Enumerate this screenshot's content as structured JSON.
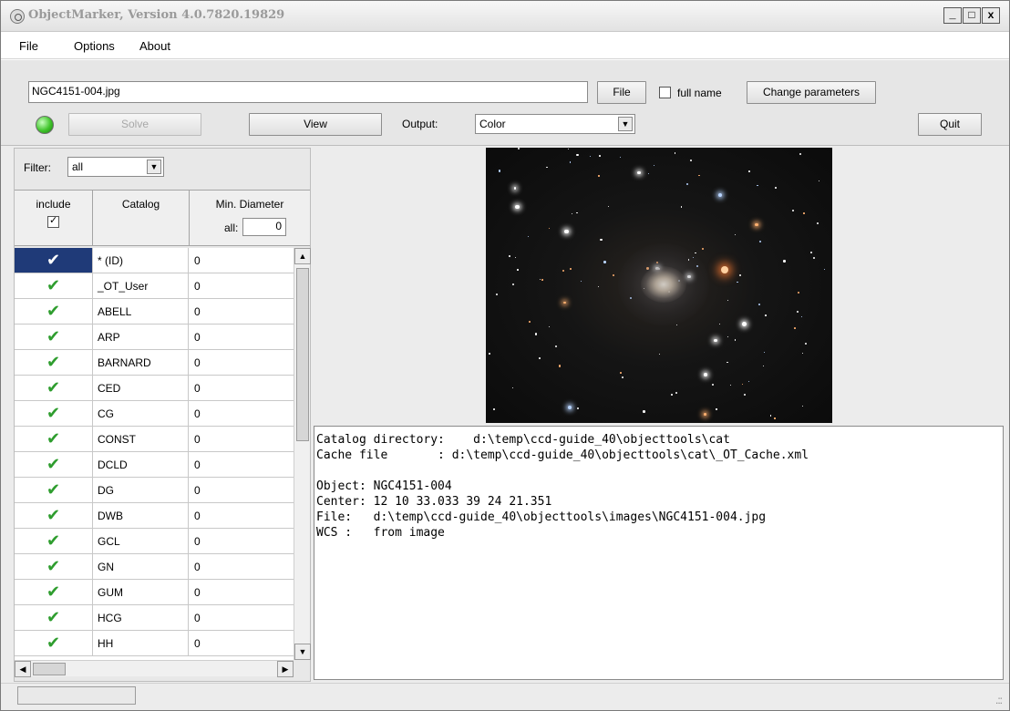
{
  "window": {
    "title": "ObjectMarker, Version 4.0.7820.19829",
    "buttons": {
      "minimize": "_",
      "maximize": "□",
      "close": "x"
    }
  },
  "menu": [
    "File",
    "Options",
    "About"
  ],
  "toolbar": {
    "filename_value": "NGC4151-004.jpg",
    "file_button": "File",
    "full_name_label": "full name",
    "full_name_checked": false,
    "change_params_button": "Change parameters",
    "solve_button": "Solve",
    "view_button": "View",
    "output_label": "Output:",
    "output_value": "Color",
    "quit_button": "Quit",
    "status_led_color": "#3fc42a"
  },
  "filter": {
    "label": "Filter:",
    "value": "all"
  },
  "grid": {
    "headers": {
      "include": "include",
      "catalog": "Catalog",
      "min_diameter": "Min. Diameter",
      "all_label": "all:",
      "all_value": "0"
    },
    "include_all_checked": true,
    "rows": [
      {
        "catalog": "* (ID)",
        "min": "0",
        "selected": true
      },
      {
        "catalog": "_OT_User",
        "min": "0"
      },
      {
        "catalog": "ABELL",
        "min": "0"
      },
      {
        "catalog": "ARP",
        "min": "0"
      },
      {
        "catalog": "BARNARD",
        "min": "0"
      },
      {
        "catalog": "CED",
        "min": "0"
      },
      {
        "catalog": "CG",
        "min": "0"
      },
      {
        "catalog": "CONST",
        "min": "0"
      },
      {
        "catalog": "DCLD",
        "min": "0"
      },
      {
        "catalog": "DG",
        "min": "0"
      },
      {
        "catalog": "DWB",
        "min": "0"
      },
      {
        "catalog": "GCL",
        "min": "0"
      },
      {
        "catalog": "GN",
        "min": "0"
      },
      {
        "catalog": "GUM",
        "min": "0"
      },
      {
        "catalog": "HCG",
        "min": "0"
      },
      {
        "catalog": "HH",
        "min": "0"
      }
    ]
  },
  "log": {
    "lines": [
      "Catalog directory:    d:\\temp\\ccd-guide_40\\objecttools\\cat",
      "Cache file       : d:\\temp\\ccd-guide_40\\objecttools\\cat\\_OT_Cache.xml",
      "",
      "Object: NGC4151-004",
      "Center: 12 10 33.033 39 24 21.351",
      "File:   d:\\temp\\ccd-guide_40\\objecttools\\images\\NGC4151-004.jpg",
      "WCS :   from image"
    ]
  }
}
